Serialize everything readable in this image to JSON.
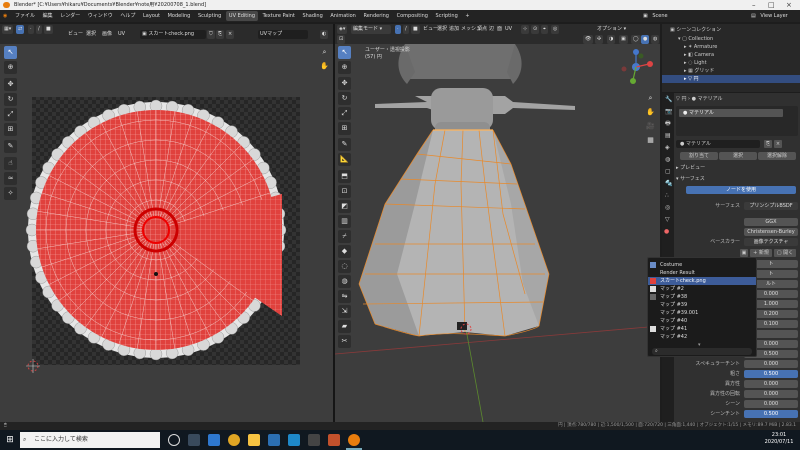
{
  "window": {
    "title": "Blender* [C:¥Users¥hikaru¥Documents¥Blender¥note用¥20200708_1.blend]"
  },
  "menu": [
    "ファイル",
    "編集",
    "レンダー",
    "ウィンドウ",
    "ヘルプ"
  ],
  "workspaces": [
    "Layout",
    "Modeling",
    "Sculpting",
    "UV Editing",
    "Texture Paint",
    "Shading",
    "Animation",
    "Rendering",
    "Compositing",
    "Scripting"
  ],
  "active_workspace": "UV Editing",
  "scene": "Scene",
  "view_layer": "View Layer",
  "uv_header": {
    "menus": [
      "ビュー",
      "選択",
      "画像",
      "UV"
    ],
    "image": "スカートcheck.png",
    "uvmap": "UVマップ"
  },
  "vp_header": {
    "mode": "編集モード",
    "menus": [
      "ビュー",
      "選択",
      "追加",
      "メッシュ",
      "頂点",
      "辺",
      "面",
      "UV"
    ],
    "options": "オプション"
  },
  "vp_overlay": {
    "line1": "ユーザー・透視投影",
    "line2": "(57) 円"
  },
  "outliner": {
    "title": "シーンコレクション",
    "rows": [
      "Collection",
      "Armature",
      "Camera",
      "Light",
      "グリッド",
      "円"
    ]
  },
  "props": {
    "object": "円",
    "material_slot": "マテリアル",
    "material_name": "マテリアル",
    "assign": "割り当て",
    "select": "選択",
    "deselect": "選択解除",
    "preview": "プレビュー",
    "surface": "サーフェス",
    "use_nodes": "ノードを使用",
    "surface_label": "サーフェス",
    "surface_value": "プリンシプルBSDF",
    "dist1": "GGX",
    "dist2": "Christensen-Burley",
    "basecolor_label": "ベースカラー",
    "basecolor_value": "画像テクスチャ",
    "new": "新規",
    "open": "開く",
    "rows": [
      {
        "label": "",
        "value": "ト"
      },
      {
        "label": "",
        "value": "ト"
      },
      {
        "label": "",
        "value": "ルト"
      },
      {
        "label": "",
        "value": "0.000"
      },
      {
        "label": "",
        "value": "1.000"
      },
      {
        "label": "",
        "value": "0.200"
      },
      {
        "label": "",
        "value": "0.100"
      },
      {
        "label": "",
        "value": ""
      },
      {
        "label": "",
        "value": "0.000"
      },
      {
        "label": "スペキュラー",
        "value": "0.500"
      },
      {
        "label": "スペキュラーチント",
        "value": "0.000"
      },
      {
        "label": "粗さ",
        "value": "0.500"
      },
      {
        "label": "異方性",
        "value": "0.000"
      },
      {
        "label": "異方性の回転",
        "value": "0.000"
      },
      {
        "label": "シーン",
        "value": "0.000"
      },
      {
        "label": "シーンチント",
        "value": "0.500"
      }
    ]
  },
  "dropdown": {
    "items": [
      "Costume",
      "Render Result",
      "スカートcheck.png",
      "マップ #2",
      "マップ #38",
      "マップ #39",
      "マップ #39.001",
      "マップ #40",
      "マップ #41",
      "マップ #42"
    ],
    "highlighted": 2
  },
  "status": {
    "right": "円 | 頂点:780/780 | 辺:1,500/1,500 | 面:720/720 | 三角面:1,440 | オブジェクト:1/15 | メモリ:89.7 MiB | 2.83.1"
  },
  "taskbar": {
    "search": "ここに入力して検索",
    "time": "23:01",
    "date": "2020/07/11"
  }
}
